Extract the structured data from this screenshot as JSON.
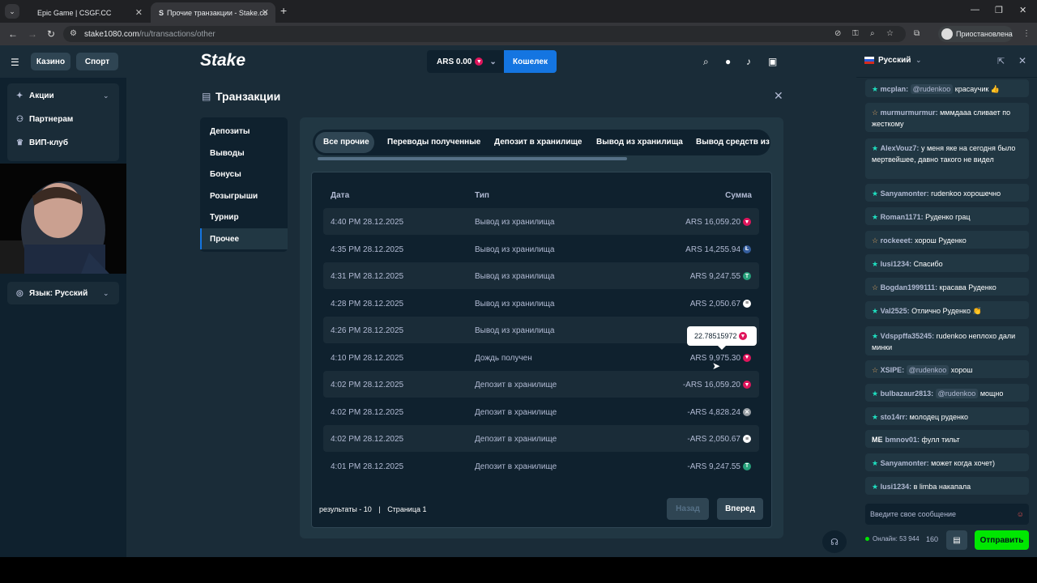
{
  "browser": {
    "tabs": [
      {
        "title": "Epic Game | CSGF.CC"
      },
      {
        "title": "Прочие транзакции - Stake.co"
      }
    ],
    "url_host": "stake1080.com",
    "url_path": "/ru/transactions/other",
    "profile_status": "Приостановлена"
  },
  "header": {
    "casino_label": "Казино",
    "sport_label": "Спорт",
    "logo_text": "Stake",
    "balance": "ARS 0.00",
    "wallet_label": "Кошелек"
  },
  "sidebar": {
    "items": [
      {
        "label": "Акции"
      },
      {
        "label": "Партнерам"
      },
      {
        "label": "ВИП-клуб"
      }
    ],
    "language": "Язык: Русский"
  },
  "page": {
    "title": "Транзакции",
    "nav": [
      {
        "label": "Депозиты"
      },
      {
        "label": "Выводы"
      },
      {
        "label": "Бонусы"
      },
      {
        "label": "Розыгрыши"
      },
      {
        "label": "Турнир"
      },
      {
        "label": "Прочее"
      }
    ],
    "filters": [
      {
        "label": "Все прочие"
      },
      {
        "label": "Переводы полученные"
      },
      {
        "label": "Депозит в хранилище"
      },
      {
        "label": "Вывод из хранилища"
      },
      {
        "label": "Вывод средств из ка"
      }
    ],
    "columns": {
      "date": "Дата",
      "type": "Тип",
      "amount": "Сумма"
    },
    "rows": [
      {
        "date": "4:40 PM 28.12.2025",
        "type": "Вывод из хранилища",
        "amount": "ARS 16,059.20",
        "coin": "trx"
      },
      {
        "date": "4:35 PM 28.12.2025",
        "type": "Вывод из хранилища",
        "amount": "ARS 14,255.94",
        "coin": "ltc"
      },
      {
        "date": "4:31 PM 28.12.2025",
        "type": "Вывод из хранилища",
        "amount": "ARS 9,247.55",
        "coin": "usdt"
      },
      {
        "date": "4:28 PM 28.12.2025",
        "type": "Вывод из хранилища",
        "amount": "ARS 2,050.67",
        "coin": "sol"
      },
      {
        "date": "4:26 PM 28.12.2025",
        "type": "Вывод из хранилища",
        "amount": "",
        "coin": ""
      },
      {
        "date": "4:10 PM 28.12.2025",
        "type": "Дождь получен",
        "amount": "ARS 9,975.30",
        "coin": "trx"
      },
      {
        "date": "4:02 PM 28.12.2025",
        "type": "Депозит в хранилище",
        "amount": "-ARS 16,059.20",
        "coin": "trx"
      },
      {
        "date": "4:02 PM 28.12.2025",
        "type": "Депозит в хранилище",
        "amount": "-ARS 4,828.24",
        "coin": "xrp"
      },
      {
        "date": "4:02 PM 28.12.2025",
        "type": "Депозит в хранилище",
        "amount": "-ARS 2,050.67",
        "coin": "sol"
      },
      {
        "date": "4:01 PM 28.12.2025",
        "type": "Депозит в хранилище",
        "amount": "-ARS 9,247.55",
        "coin": "usdt"
      }
    ],
    "tooltip": "22.78515972",
    "results": "результаты - 10",
    "page_label": "Страница 1",
    "prev_label": "Назад",
    "next_label": "Вперед"
  },
  "chat": {
    "language": "Русский",
    "messages": [
      {
        "user": "mcplan:",
        "tag": "@rudenkoo",
        "text": "красаучик 👍"
      },
      {
        "user": "murmurmurmur:",
        "tag": "",
        "text": "мммдааа сливает по жесткому"
      },
      {
        "user": "AlexVouz7:",
        "tag": "",
        "text": "у меня яке на сегодня было мертвейшее, давно такого не видел"
      },
      {
        "user": "Sanyamonter:",
        "tag": "",
        "text": "rudenkoo хорошечно"
      },
      {
        "user": "Roman1171:",
        "tag": "",
        "text": "Руденко грац"
      },
      {
        "user": "rockeeet:",
        "tag": "",
        "text": "хорош Руденко"
      },
      {
        "user": "lusi1234:",
        "tag": "",
        "text": "Спасибо"
      },
      {
        "user": "Bogdan1999111:",
        "tag": "",
        "text": "красава Руденко"
      },
      {
        "user": "Val2525:",
        "tag": "",
        "text": "Отлично Руденко 👏"
      },
      {
        "user": "Vdsppffa35245:",
        "tag": "",
        "text": "rudenkoo неплохо дали минки"
      },
      {
        "user": "XSIPE:",
        "tag": "@rudenkoo",
        "text": "хорош"
      },
      {
        "user": "bulbazaur2813:",
        "tag": "@rudenkoo",
        "text": "мощно"
      },
      {
        "user": "sto14rr:",
        "tag": "",
        "text": "молодец руденко"
      },
      {
        "user": "bmnov01:",
        "tag": "",
        "text": "фулл тильт",
        "badge": "ME"
      },
      {
        "user": "Sanyamonter:",
        "tag": "",
        "text": "может когда хочет)"
      },
      {
        "user": "lusi1234:",
        "tag": "",
        "text": "в limba накапала"
      }
    ],
    "input_placeholder": "Введите свое сообщение",
    "online": "Онлайн: 53 944",
    "count": "160",
    "send_label": "Отправить"
  },
  "colors": {
    "accent": "#1475e1",
    "send": "#00e701",
    "trx": "#e0155c",
    "ltc": "#345d9d",
    "usdt": "#26a17b",
    "sol": "#ffffff",
    "xrp": "#9aa0a6"
  }
}
